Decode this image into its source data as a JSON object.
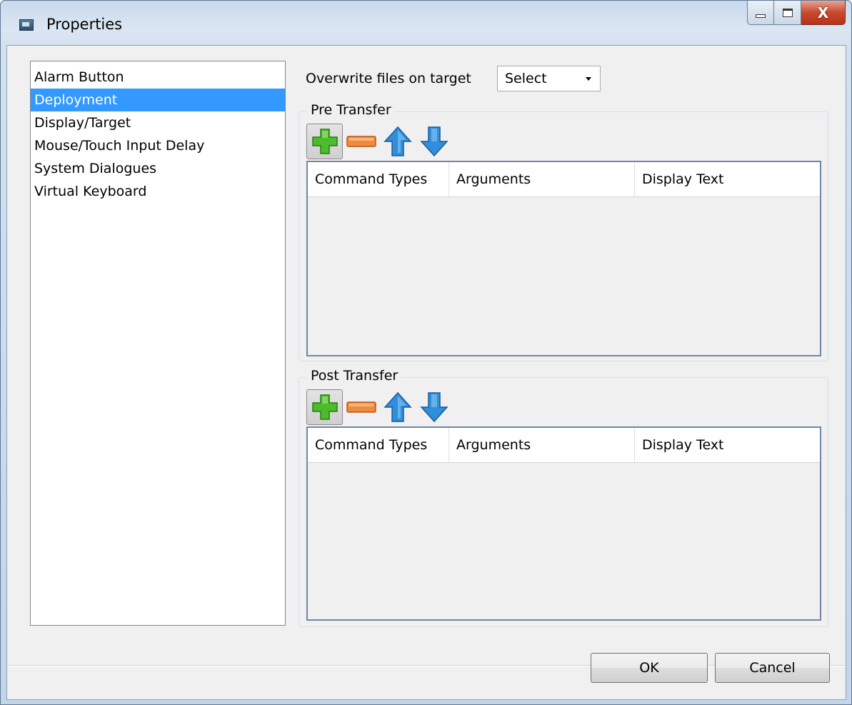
{
  "window": {
    "title": "Properties",
    "close_symbol": "X"
  },
  "nav": {
    "items": [
      {
        "label": "Alarm Button",
        "selected": false
      },
      {
        "label": "Deployment",
        "selected": true
      },
      {
        "label": "Display/Target",
        "selected": false
      },
      {
        "label": "Mouse/Touch Input Delay",
        "selected": false
      },
      {
        "label": "System Dialogues",
        "selected": false
      },
      {
        "label": "Virtual Keyboard",
        "selected": false
      }
    ]
  },
  "overwrite": {
    "label": "Overwrite files on target",
    "value": "Select"
  },
  "pre_transfer": {
    "title": "Pre Transfer",
    "columns": [
      "Command Types",
      "Arguments",
      "Display Text"
    ]
  },
  "post_transfer": {
    "title": "Post Transfer",
    "columns": [
      "Command Types",
      "Arguments",
      "Display Text"
    ]
  },
  "toolbar_icons": [
    "add-icon",
    "remove-icon",
    "move-up-icon",
    "move-down-icon"
  ],
  "colors": {
    "selection": "#3399ff",
    "add": "#4cbb2c",
    "remove": "#f08a3c",
    "arrows": "#2f8fdc"
  },
  "footer": {
    "ok_label": "OK",
    "cancel_label": "Cancel"
  }
}
